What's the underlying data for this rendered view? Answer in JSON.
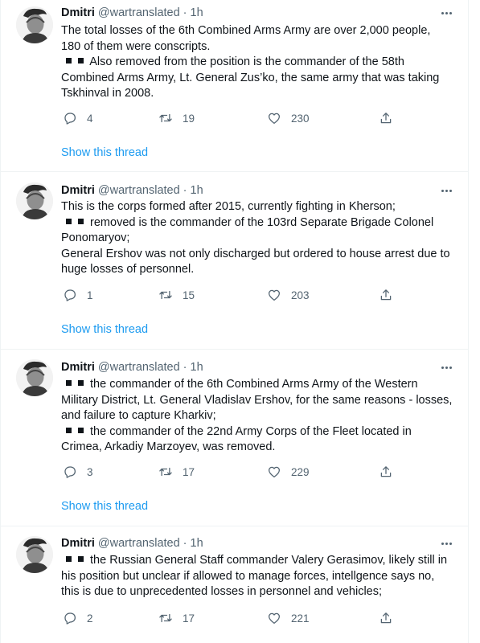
{
  "tweets": [
    {
      "name": "Dmitri",
      "handle": "@wartranslated",
      "time": "1h",
      "lines": [
        "The total losses of the 6th Combined Arms Army are over 2,000 people,",
        "180 of them were conscripts.",
        "Also removed from the position is the commander of the 58th",
        "Combined Arms Army, Lt. General Zus’ko, the same army that was taking",
        "Tskhinval in 2008."
      ],
      "replies": "4",
      "retweets": "19",
      "likes": "230",
      "show_thread": "Show this thread"
    },
    {
      "name": "Dmitri",
      "handle": "@wartranslated",
      "time": "1h",
      "lines": [
        "This is the corps formed after 2015, currently fighting in Kherson;",
        "removed is the commander of the 103rd Separate Brigade Colonel",
        "Ponomaryov;",
        "General Ershov was not only discharged but ordered to house arrest due to",
        "huge losses of personnel."
      ],
      "replies": "1",
      "retweets": "15",
      "likes": "203",
      "show_thread": "Show this thread"
    },
    {
      "name": "Dmitri",
      "handle": "@wartranslated",
      "time": "1h",
      "lines": [
        "the commander of the 6th Combined Arms Army of the Western",
        "Military District, Lt. General Vladislav Ershov, for the same reasons - losses,",
        "and failure to capture Kharkiv;",
        "the commander of the 22nd Army Corps of the Fleet located in",
        "Crimea, Arkadiy Marzoyev, was removed."
      ],
      "replies": "3",
      "retweets": "17",
      "likes": "229",
      "show_thread": "Show this thread"
    },
    {
      "name": "Dmitri",
      "handle": "@wartranslated",
      "time": "1h",
      "lines": [
        "the Russian General Staff commander Valery Gerasimov, likely still in",
        "his position but unclear if allowed to manage forces, intellgence says no,",
        "this is due to unprecedented losses in personnel and vehicles;"
      ],
      "replies": "2",
      "retweets": "17",
      "likes": "221"
    }
  ],
  "colors": {
    "text": "#0f1419",
    "secondary": "#536471",
    "link": "#1d9bf0",
    "divider": "#eff3f4"
  },
  "icons": [
    "reply-icon",
    "retweet-icon",
    "like-icon",
    "share-icon",
    "more-icon",
    "square-bullet-icon"
  ]
}
